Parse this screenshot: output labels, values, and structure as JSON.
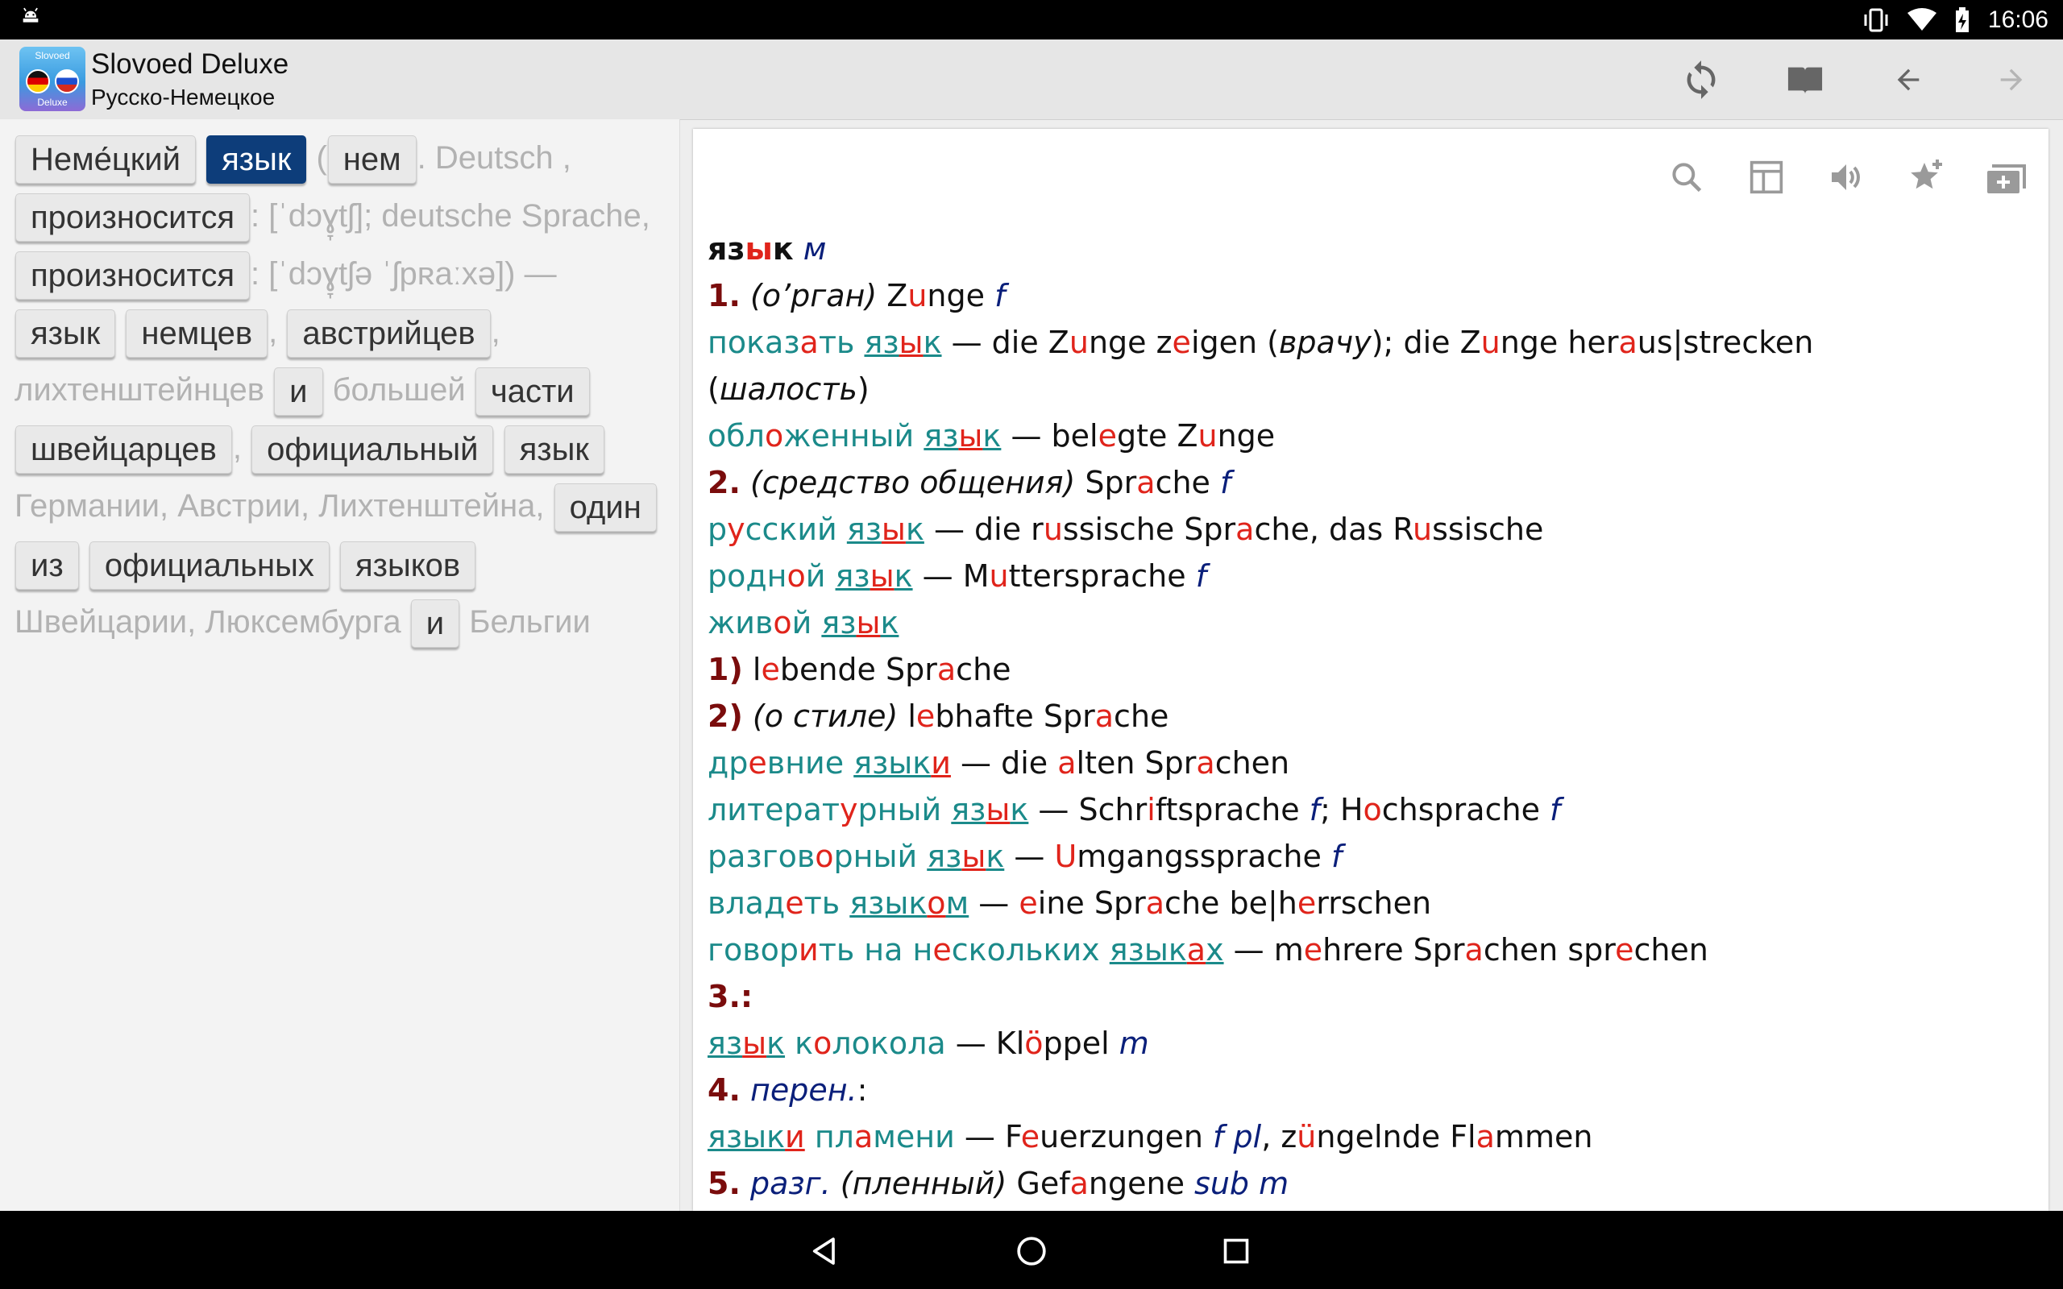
{
  "status_bar": {
    "time": "16:06",
    "icons": [
      "android-icon",
      "vibrate-icon",
      "wifi-icon",
      "battery-charging-icon"
    ]
  },
  "app": {
    "title": "Slovoed Deluxe",
    "subtitle": "Русско-Немецкое",
    "logo_top": "Slovoed",
    "logo_bottom": "Deluxe"
  },
  "toolbar": {
    "icons": [
      "sync-icon",
      "book-icon",
      "back-arrow-icon",
      "forward-arrow-icon"
    ]
  },
  "left_pane": {
    "sentence": [
      {
        "t": "Неме́цкий",
        "tok": true
      },
      {
        "t": " ",
        "tok": false
      },
      {
        "t": "язык",
        "tok": true,
        "sel": true
      },
      {
        "t": " (",
        "tok": false
      },
      {
        "t": "нем",
        "tok": true
      },
      {
        "t": ". Deutsch , ",
        "tok": false
      },
      {
        "t": "произносится",
        "tok": true
      },
      {
        "t": ": [ˈdɔɣ̞tʃ]; deutsche Sprache, ",
        "tok": false
      },
      {
        "t": "произносится",
        "tok": true
      },
      {
        "t": ": [ˈdɔɣ̞tʃə ˈʃpʀaːxə]) — ",
        "tok": false
      },
      {
        "t": "язык",
        "tok": true
      },
      {
        "t": " ",
        "tok": false
      },
      {
        "t": "немцев",
        "tok": true
      },
      {
        "t": ", ",
        "tok": false
      },
      {
        "t": "австрийцев",
        "tok": true
      },
      {
        "t": ", лихтенштейнцев ",
        "tok": false
      },
      {
        "t": "и",
        "tok": true
      },
      {
        "t": " большей ",
        "tok": false
      },
      {
        "t": "части",
        "tok": true
      },
      {
        "t": " ",
        "tok": false
      },
      {
        "t": "швейцарцев",
        "tok": true
      },
      {
        "t": ", ",
        "tok": false
      },
      {
        "t": "официальный",
        "tok": true
      },
      {
        "t": " ",
        "tok": false
      },
      {
        "t": "язык",
        "tok": true
      },
      {
        "t": " Германии, Австрии, Лихтенштейна, ",
        "tok": false
      },
      {
        "t": "один",
        "tok": true
      },
      {
        "t": " ",
        "tok": false
      },
      {
        "t": "из",
        "tok": true
      },
      {
        "t": " ",
        "tok": false
      },
      {
        "t": "официальных",
        "tok": true
      },
      {
        "t": " ",
        "tok": false
      },
      {
        "t": "языков",
        "tok": true
      },
      {
        "t": " Швейцарии, Люксембурга ",
        "tok": false
      },
      {
        "t": "и",
        "tok": true
      },
      {
        "t": " Бельгии",
        "tok": false
      }
    ]
  },
  "right_toolbar": {
    "icons": [
      "search-icon",
      "table-icon",
      "speaker-icon",
      "favorite-add-icon",
      "new-card-icon"
    ]
  },
  "article": {
    "lines": [
      [
        {
          "c": "hw",
          "t": "яз"
        },
        {
          "c": "hw hl",
          "t": "ы"
        },
        {
          "c": "hw",
          "t": "к"
        },
        {
          "c": "",
          "t": " "
        },
        {
          "c": "gr",
          "t": "м"
        }
      ],
      [
        {
          "c": "num",
          "t": "1."
        },
        {
          "c": "",
          "t": " "
        },
        {
          "c": "it",
          "t": "(о’рган)"
        },
        {
          "c": "",
          "t": " Z"
        },
        {
          "c": "hl",
          "t": "u"
        },
        {
          "c": "",
          "t": "nge "
        },
        {
          "c": "gr",
          "t": "f"
        }
      ],
      [
        {
          "c": "ru",
          "t": "показ"
        },
        {
          "c": "ru hl",
          "t": "а"
        },
        {
          "c": "ru",
          "t": "ть "
        },
        {
          "c": "lnk",
          "t": "яз"
        },
        {
          "c": "lnk hl",
          "t": "ы"
        },
        {
          "c": "lnk",
          "t": "к"
        },
        {
          "c": "",
          "t": " — die Z"
        },
        {
          "c": "hl",
          "t": "u"
        },
        {
          "c": "",
          "t": "nge z"
        },
        {
          "c": "hl",
          "t": "e"
        },
        {
          "c": "",
          "t": "igen ("
        },
        {
          "c": "it",
          "t": "врачу"
        },
        {
          "c": "",
          "t": "); die Z"
        },
        {
          "c": "hl",
          "t": "u"
        },
        {
          "c": "",
          "t": "nge her"
        },
        {
          "c": "hl",
          "t": "a"
        },
        {
          "c": "",
          "t": "us|strecken"
        }
      ],
      [
        {
          "c": "",
          "t": "("
        },
        {
          "c": "it",
          "t": "шалость"
        },
        {
          "c": "",
          "t": ")"
        }
      ],
      [
        {
          "c": "ru",
          "t": "обл"
        },
        {
          "c": "ru hl",
          "t": "о"
        },
        {
          "c": "ru",
          "t": "женный "
        },
        {
          "c": "lnk",
          "t": "яз"
        },
        {
          "c": "lnk hl",
          "t": "ы"
        },
        {
          "c": "lnk",
          "t": "к"
        },
        {
          "c": "",
          "t": " — bel"
        },
        {
          "c": "hl",
          "t": "e"
        },
        {
          "c": "",
          "t": "gte Z"
        },
        {
          "c": "hl",
          "t": "u"
        },
        {
          "c": "",
          "t": "nge"
        }
      ],
      [
        {
          "c": "num",
          "t": "2."
        },
        {
          "c": "",
          "t": " "
        },
        {
          "c": "it",
          "t": "(средство общения)"
        },
        {
          "c": "",
          "t": " Spr"
        },
        {
          "c": "hl",
          "t": "a"
        },
        {
          "c": "",
          "t": "che "
        },
        {
          "c": "gr",
          "t": "f"
        }
      ],
      [
        {
          "c": "ru",
          "t": "р"
        },
        {
          "c": "ru hl",
          "t": "у"
        },
        {
          "c": "ru",
          "t": "сский "
        },
        {
          "c": "lnk",
          "t": "яз"
        },
        {
          "c": "lnk hl",
          "t": "ы"
        },
        {
          "c": "lnk",
          "t": "к"
        },
        {
          "c": "",
          "t": " — die r"
        },
        {
          "c": "hl",
          "t": "u"
        },
        {
          "c": "",
          "t": "ssische Spr"
        },
        {
          "c": "hl",
          "t": "a"
        },
        {
          "c": "",
          "t": "che, das R"
        },
        {
          "c": "hl",
          "t": "u"
        },
        {
          "c": "",
          "t": "ssische"
        }
      ],
      [
        {
          "c": "ru",
          "t": "родн"
        },
        {
          "c": "ru hl",
          "t": "о"
        },
        {
          "c": "ru",
          "t": "й "
        },
        {
          "c": "lnk",
          "t": "яз"
        },
        {
          "c": "lnk hl",
          "t": "ы"
        },
        {
          "c": "lnk",
          "t": "к"
        },
        {
          "c": "",
          "t": " — M"
        },
        {
          "c": "hl",
          "t": "u"
        },
        {
          "c": "",
          "t": "ttersprache "
        },
        {
          "c": "gr",
          "t": "f"
        }
      ],
      [
        {
          "c": "ru",
          "t": "жив"
        },
        {
          "c": "ru hl",
          "t": "о"
        },
        {
          "c": "ru",
          "t": "й "
        },
        {
          "c": "lnk",
          "t": "яз"
        },
        {
          "c": "lnk hl",
          "t": "ы"
        },
        {
          "c": "lnk",
          "t": "к"
        }
      ],
      [
        {
          "c": "num",
          "t": "1)"
        },
        {
          "c": "",
          "t": " l"
        },
        {
          "c": "hl",
          "t": "e"
        },
        {
          "c": "",
          "t": "bende Spr"
        },
        {
          "c": "hl",
          "t": "a"
        },
        {
          "c": "",
          "t": "che"
        }
      ],
      [
        {
          "c": "num",
          "t": "2)"
        },
        {
          "c": "",
          "t": " "
        },
        {
          "c": "it",
          "t": "(о стиле)"
        },
        {
          "c": "",
          "t": " l"
        },
        {
          "c": "hl",
          "t": "e"
        },
        {
          "c": "",
          "t": "bhafte Spr"
        },
        {
          "c": "hl",
          "t": "a"
        },
        {
          "c": "",
          "t": "che"
        }
      ],
      [
        {
          "c": "ru",
          "t": "др"
        },
        {
          "c": "ru hl",
          "t": "е"
        },
        {
          "c": "ru",
          "t": "вние "
        },
        {
          "c": "lnk",
          "t": "язык"
        },
        {
          "c": "lnk hl",
          "t": "и"
        },
        {
          "c": "",
          "t": " — die "
        },
        {
          "c": "hl",
          "t": "a"
        },
        {
          "c": "",
          "t": "lten Spr"
        },
        {
          "c": "hl",
          "t": "a"
        },
        {
          "c": "",
          "t": "chen"
        }
      ],
      [
        {
          "c": "ru",
          "t": "литерат"
        },
        {
          "c": "ru hl",
          "t": "у"
        },
        {
          "c": "ru",
          "t": "рный "
        },
        {
          "c": "lnk",
          "t": "яз"
        },
        {
          "c": "lnk hl",
          "t": "ы"
        },
        {
          "c": "lnk",
          "t": "к"
        },
        {
          "c": "",
          "t": " — Schr"
        },
        {
          "c": "hl",
          "t": "i"
        },
        {
          "c": "",
          "t": "ftsprache "
        },
        {
          "c": "gr",
          "t": "f"
        },
        {
          "c": "",
          "t": "; H"
        },
        {
          "c": "hl",
          "t": "o"
        },
        {
          "c": "",
          "t": "chsprache "
        },
        {
          "c": "gr",
          "t": "f"
        }
      ],
      [
        {
          "c": "ru",
          "t": "разгов"
        },
        {
          "c": "ru hl",
          "t": "о"
        },
        {
          "c": "ru",
          "t": "рный "
        },
        {
          "c": "lnk",
          "t": "яз"
        },
        {
          "c": "lnk hl",
          "t": "ы"
        },
        {
          "c": "lnk",
          "t": "к"
        },
        {
          "c": "",
          "t": " — "
        },
        {
          "c": "hl",
          "t": "U"
        },
        {
          "c": "",
          "t": "mgangssprache "
        },
        {
          "c": "gr",
          "t": "f"
        }
      ],
      [
        {
          "c": "ru",
          "t": "влад"
        },
        {
          "c": "ru hl",
          "t": "е"
        },
        {
          "c": "ru",
          "t": "ть "
        },
        {
          "c": "lnk",
          "t": "язык"
        },
        {
          "c": "lnk hl",
          "t": "о"
        },
        {
          "c": "lnk",
          "t": "м"
        },
        {
          "c": "",
          "t": " — "
        },
        {
          "c": "hl",
          "t": "e"
        },
        {
          "c": "",
          "t": "ine Spr"
        },
        {
          "c": "hl",
          "t": "a"
        },
        {
          "c": "",
          "t": "che be|h"
        },
        {
          "c": "hl",
          "t": "e"
        },
        {
          "c": "",
          "t": "rrschen"
        }
      ],
      [
        {
          "c": "ru",
          "t": "говор"
        },
        {
          "c": "ru hl",
          "t": "и"
        },
        {
          "c": "ru",
          "t": "ть на н"
        },
        {
          "c": "ru hl",
          "t": "е"
        },
        {
          "c": "ru",
          "t": "скольких "
        },
        {
          "c": "lnk",
          "t": "язык"
        },
        {
          "c": "lnk hl",
          "t": "а"
        },
        {
          "c": "lnk",
          "t": "х"
        },
        {
          "c": "",
          "t": " — m"
        },
        {
          "c": "hl",
          "t": "e"
        },
        {
          "c": "",
          "t": "hrere Spr"
        },
        {
          "c": "hl",
          "t": "a"
        },
        {
          "c": "",
          "t": "chen spr"
        },
        {
          "c": "hl",
          "t": "e"
        },
        {
          "c": "",
          "t": "chen"
        }
      ],
      [
        {
          "c": "num",
          "t": "3.:"
        }
      ],
      [
        {
          "c": "lnk",
          "t": "яз"
        },
        {
          "c": "lnk hl",
          "t": "ы"
        },
        {
          "c": "lnk",
          "t": "к"
        },
        {
          "c": "ru",
          "t": " к"
        },
        {
          "c": "ru hl",
          "t": "о"
        },
        {
          "c": "ru",
          "t": "локола"
        },
        {
          "c": "",
          "t": " — Kl"
        },
        {
          "c": "hl",
          "t": "ö"
        },
        {
          "c": "",
          "t": "ppel "
        },
        {
          "c": "gr",
          "t": "m"
        }
      ],
      [
        {
          "c": "num",
          "t": "4."
        },
        {
          "c": "",
          "t": " "
        },
        {
          "c": "gr",
          "t": "перен."
        },
        {
          "c": "",
          "t": ":"
        }
      ],
      [
        {
          "c": "lnk",
          "t": "язык"
        },
        {
          "c": "lnk hl",
          "t": "и"
        },
        {
          "c": "ru",
          "t": " пл"
        },
        {
          "c": "ru hl",
          "t": "а"
        },
        {
          "c": "ru",
          "t": "мени"
        },
        {
          "c": "",
          "t": " — F"
        },
        {
          "c": "hl",
          "t": "e"
        },
        {
          "c": "",
          "t": "uerzungen "
        },
        {
          "c": "gr",
          "t": "f pl"
        },
        {
          "c": "",
          "t": ", z"
        },
        {
          "c": "hl",
          "t": "ü"
        },
        {
          "c": "",
          "t": "ngelnde Fl"
        },
        {
          "c": "hl",
          "t": "a"
        },
        {
          "c": "",
          "t": "mmen"
        }
      ],
      [
        {
          "c": "num",
          "t": "5."
        },
        {
          "c": "",
          "t": " "
        },
        {
          "c": "gr",
          "t": "разг."
        },
        {
          "c": "",
          "t": " "
        },
        {
          "c": "it",
          "t": "(пленный)"
        },
        {
          "c": "",
          "t": " Gef"
        },
        {
          "c": "hl",
          "t": "a"
        },
        {
          "c": "",
          "t": "ngene "
        },
        {
          "c": "gr",
          "t": "sub m"
        }
      ]
    ]
  },
  "nav_bar": {
    "icons": [
      "back-triangle-icon",
      "home-circle-icon",
      "recents-square-icon"
    ]
  }
}
